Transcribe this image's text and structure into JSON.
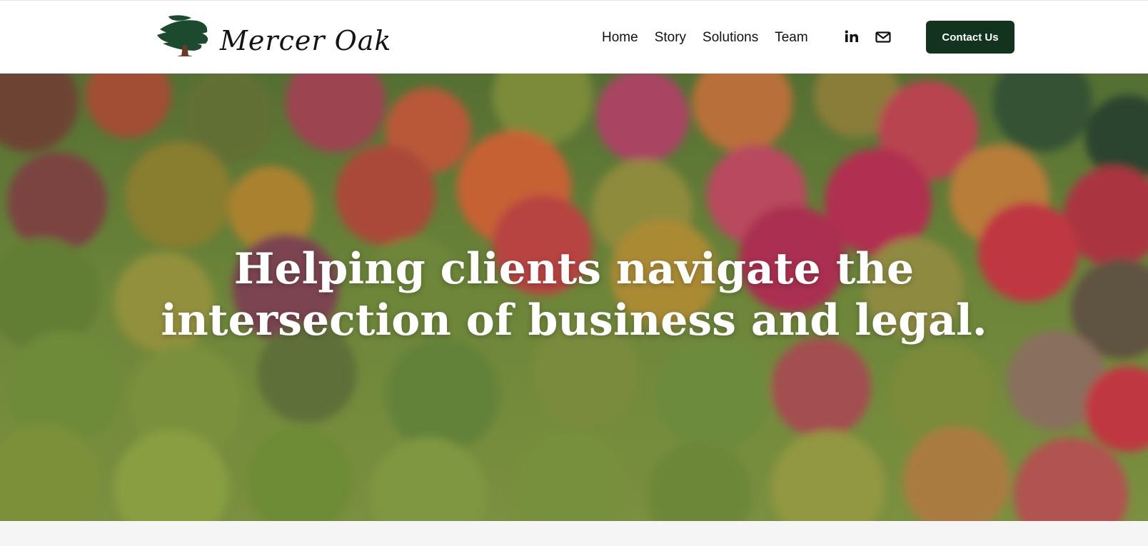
{
  "brand": {
    "name": "Mercer Oak",
    "logo_icon": "oak-tree-icon",
    "colors": {
      "primary": "#12341f",
      "tree_canopy": "#1c4a2e",
      "tree_trunk": "#6b3a22"
    }
  },
  "nav": {
    "items": [
      {
        "label": "Home"
      },
      {
        "label": "Story"
      },
      {
        "label": "Solutions"
      },
      {
        "label": "Team"
      }
    ]
  },
  "social": {
    "linkedin_icon": "linkedin-icon",
    "email_icon": "mail-icon"
  },
  "cta": {
    "label": "Contact Us"
  },
  "hero": {
    "headline_line1": "Helping clients navigate the",
    "headline_line2": "intersection of business and legal.",
    "background": "autumn-forest-aerial-image"
  }
}
